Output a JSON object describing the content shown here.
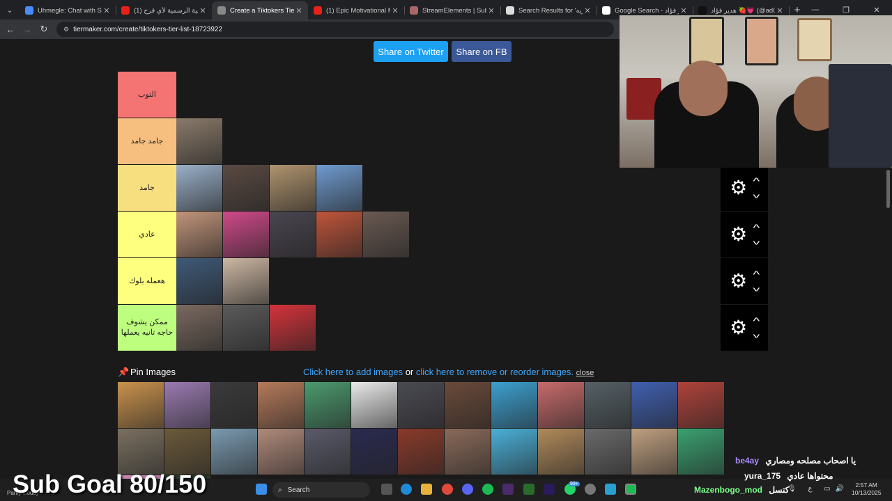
{
  "browser": {
    "tabs": [
      {
        "title": "Uhmegle: Chat with Stran",
        "fav": "#4a8cff"
      },
      {
        "title": "(1) الأغنية الرسمية لأي قرح",
        "fav": "#e62117"
      },
      {
        "title": "Create a Tiktokers Tier Lis",
        "fav": "#888888"
      },
      {
        "title": "(1) Epic Motivational Musi",
        "fav": "#e62117"
      },
      {
        "title": "StreamElements | Subath",
        "fav": "#a66"
      },
      {
        "title": "Search Results for 'مصريه",
        "fav": "#ddd"
      },
      {
        "title": "Google Search - هدير فؤاد",
        "fav": "#fff"
      },
      {
        "title": "هدير فؤاد 🍓💗 (@ad00",
        "fav": "#111"
      }
    ],
    "active_tab": 2,
    "url": "tiermaker.com/create/tiktokers-tier-list-18723922"
  },
  "page": {
    "share_twitter": "Share on Twitter",
    "share_fb": "Share on FB",
    "tiers": [
      {
        "label": "التوب",
        "color": "#f47474",
        "images": []
      },
      {
        "label": "جامد جامد",
        "color": "#f7bf7f",
        "images": [
          "#8a7a6a"
        ]
      },
      {
        "label": "جامد",
        "color": "#f7df80",
        "images": [
          "#9ab0c8",
          "#5a4a42",
          "#b0946e",
          "#6f9bd0"
        ]
      },
      {
        "label": "عادي",
        "color": "#fefe7f",
        "images": [
          "#c2957a",
          "#d04a8a",
          "#4a4650",
          "#c0553a",
          "#6a5a52"
        ]
      },
      {
        "label": "هعمله بلوك",
        "color": "#fefe7f",
        "images": [
          "#3f5a78",
          "#cdb8a4"
        ]
      },
      {
        "label": "ممكن يشوف حاجه تانيه يعملها",
        "color": "#bdfe7f",
        "images": [
          "#7a6a60",
          "#5b5b5b",
          "#d5333a"
        ]
      }
    ],
    "pin_label": "Pin Images",
    "add_images": "Click here to add images",
    "or_text": "or",
    "remove_images": "click here to remove or reorder images.",
    "close": "close",
    "pool_images": [
      "#c9924d",
      "#9a7ab0",
      "#3a3a3a",
      "#b57a5a",
      "#4b9a6e",
      "#eaeaea",
      "#4a4a52",
      "#6a4a3a",
      "#3ca0d0",
      "#c76a6a",
      "#556066",
      "#3f5fb0",
      "#b0423a",
      "#7a7060",
      "#6b5a3a",
      "#7a9ab0",
      "#b08a7a",
      "#5a5a6a",
      "#2a2a50",
      "#8a3a2a",
      "#8a6a5a",
      "#4ab0d8",
      "#b08a5a",
      "#6a6a6a",
      "#c0a080",
      "#3aa070",
      "#d08aba",
      "#2a3a2a"
    ]
  },
  "overlay": {
    "sub_goal": "Sub Goal 80/150",
    "chat": [
      {
        "user": "be4ay",
        "text": "يا اصحاب مصلحه ومصاري",
        "color": "#a98cff"
      },
      {
        "user": "yura_175",
        "text": "محتواها عادي",
        "color": "#ffffff"
      },
      {
        "user": "Mazenbogo_mod",
        "text": "كتسل",
        "color": "#7cff8c"
      }
    ]
  },
  "taskbar": {
    "search": "Search",
    "time": "2:57 AM",
    "date": "10/13/2025",
    "weather": "Partly cloudy",
    "lang": "ع",
    "badge": "99+"
  }
}
